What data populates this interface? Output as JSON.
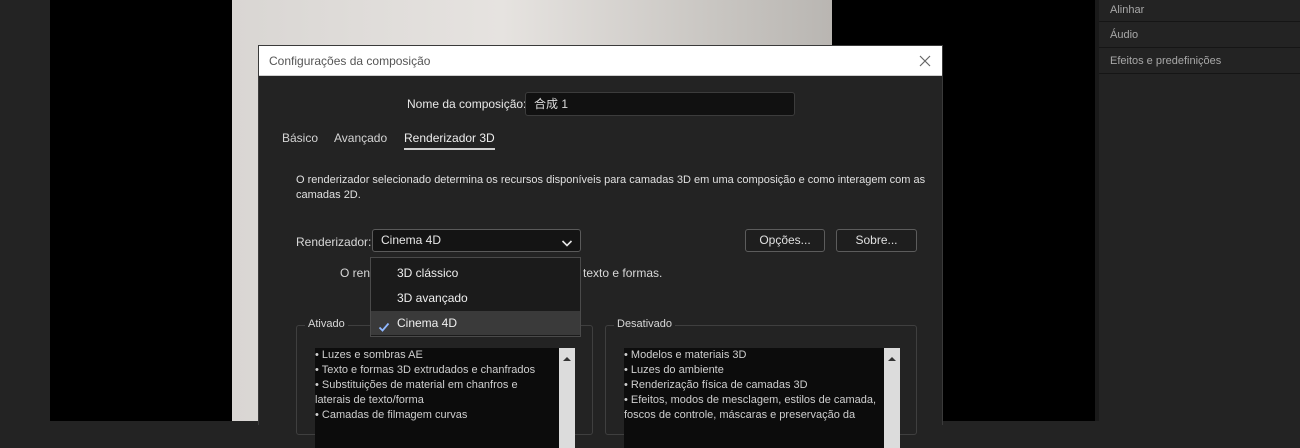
{
  "right_panel": {
    "items": [
      {
        "label": "Alinhar"
      },
      {
        "label": "Áudio"
      },
      {
        "label": "Efeitos e predefinições"
      }
    ]
  },
  "dialog": {
    "title": "Configurações da composição",
    "close_icon": "close-icon",
    "name_label": "Nome da composição:",
    "name_value": "合成 1",
    "tabs": [
      {
        "label": "Básico"
      },
      {
        "label": "Avançado"
      },
      {
        "label": "Renderizador 3D",
        "active": true
      }
    ],
    "description": "O renderizador selecionado determina os recursos disponíveis para camadas 3D em uma composição e como interagem com as camadas 2D.",
    "renderer_label": "Renderizador:",
    "renderer_value": "Cinema 4D",
    "options_button": "Opções...",
    "about_button": "Sobre...",
    "note_start": "O rend",
    "note_end": "texto e formas.",
    "enabled": {
      "legend": "Ativado",
      "lines": [
        "• Luzes e sombras AE",
        "• Texto e formas 3D extrudados e chanfrados",
        "• Substituições de material em chanfros e",
        "laterais de texto/forma",
        "• Camadas de filmagem curvas"
      ]
    },
    "disabled": {
      "legend": "Desativado",
      "lines": [
        "• Modelos e materiais 3D",
        "• Luzes do ambiente",
        "• Renderização física de camadas 3D",
        "• Efeitos, modos de mesclagem, estilos de camada,",
        "foscos de controle, máscaras e preservação da"
      ]
    },
    "dropdown": {
      "options": [
        {
          "label": "3D clássico"
        },
        {
          "label": "3D avançado"
        },
        {
          "label": "Cinema 4D",
          "selected": true
        }
      ]
    }
  },
  "colors": {
    "dialog_bg": "#232323",
    "titlebar_bg": "#ffffff",
    "accent_check": "#8fb7ff"
  }
}
